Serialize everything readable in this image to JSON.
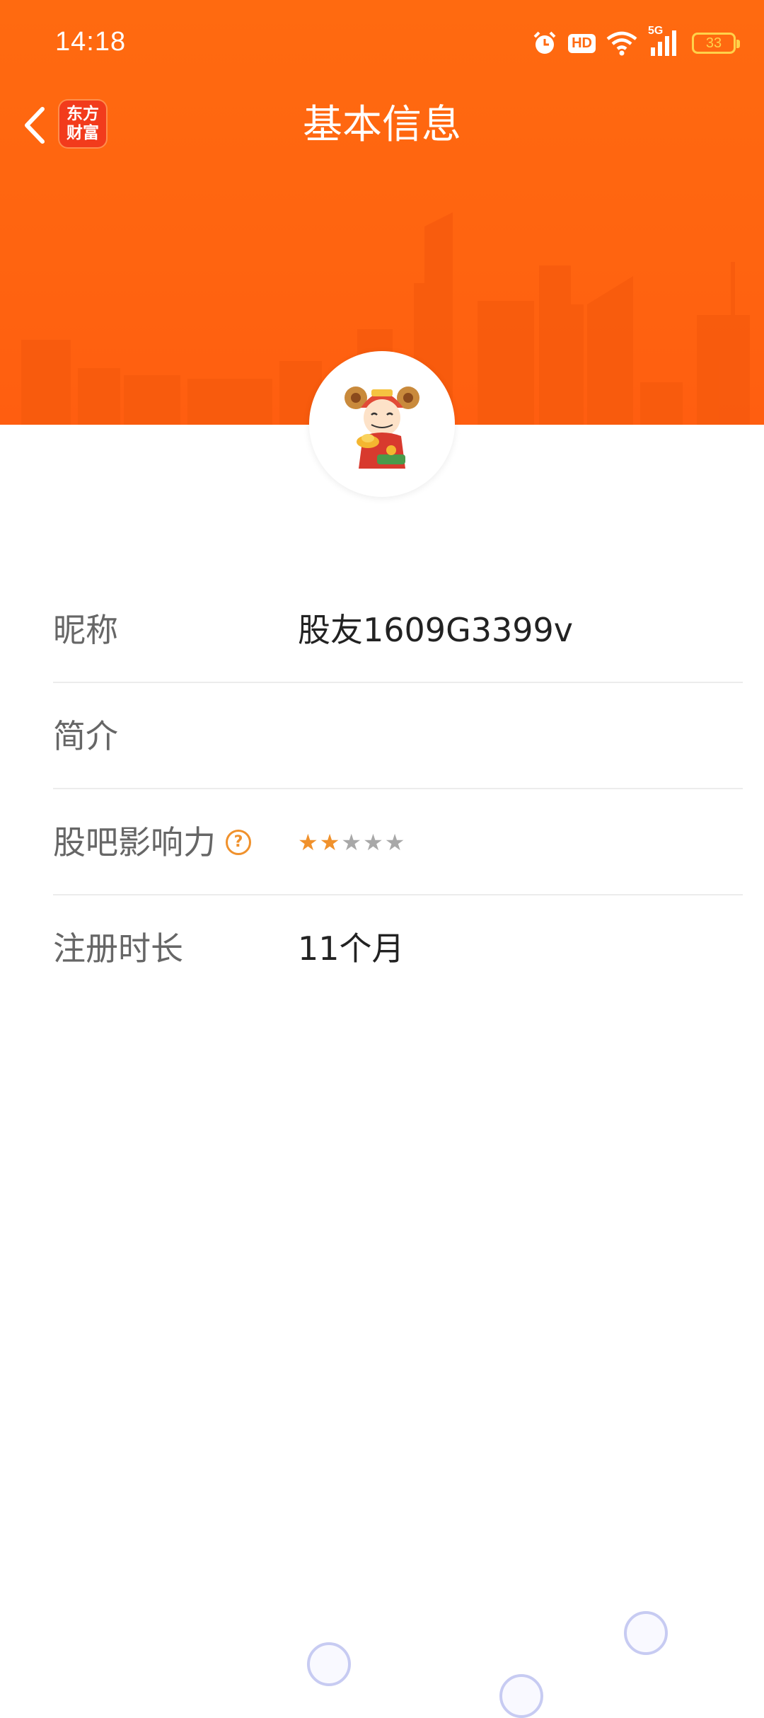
{
  "status_bar": {
    "time": "14:18",
    "icons": [
      "alarm-icon",
      "hd-icon",
      "wifi-icon",
      "5g-signal-icon",
      "battery-icon"
    ],
    "hd_label": "HD",
    "network_label": "5G",
    "battery_level": "33"
  },
  "header": {
    "title": "基本信息",
    "logo_line1": "东方",
    "logo_line2": "财富",
    "accent_color": "#ff6a10"
  },
  "profile": {
    "rows": [
      {
        "label": "昵称",
        "value": "股友1609G3399v"
      },
      {
        "label": "简介",
        "value": ""
      },
      {
        "label": "股吧影响力",
        "help": "?",
        "rating": 2,
        "rating_max": 5
      },
      {
        "label": "注册时长",
        "value": "11个月"
      }
    ]
  },
  "colors": {
    "star_on": "#f0912c",
    "star_off": "#a8a8a8",
    "label": "#666666",
    "value": "#222222"
  }
}
